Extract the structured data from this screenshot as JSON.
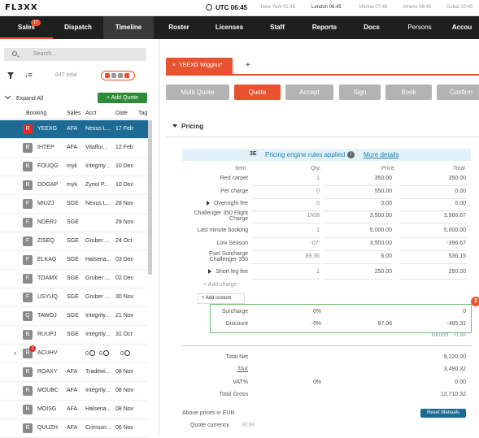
{
  "app": {
    "logo": "FL3XX"
  },
  "clocks": [
    {
      "id": "utc",
      "text": "UTC 06:45"
    },
    {
      "id": "ny",
      "text": "New York 01:45"
    },
    {
      "id": "london",
      "text": "London 06:45"
    },
    {
      "id": "vienna",
      "text": "Vienna 07:45"
    },
    {
      "id": "athens",
      "text": "Athens 08:45"
    },
    {
      "id": "dubai",
      "text": "Dubai 10:45"
    }
  ],
  "nav": {
    "items": [
      {
        "label": "Sales",
        "badge": "17"
      },
      {
        "label": "Dispatch"
      },
      {
        "label": "Timeline"
      },
      {
        "label": "Roster"
      },
      {
        "label": "Licenses"
      },
      {
        "label": "Staff"
      },
      {
        "label": "Reports"
      },
      {
        "label": "Docs"
      },
      {
        "label": "Persons"
      },
      {
        "label": "Accou"
      }
    ]
  },
  "sidebar": {
    "search_placeholder": "Search...",
    "total": "647 total",
    "add_quote": "+ Add Quote",
    "expand_all": "Expand All",
    "columns": [
      "Booking",
      "Sales",
      "Acct",
      "Date",
      "Tag"
    ],
    "rows": [
      {
        "s": "R",
        "booking": "YEEXG",
        "sales": "AFA",
        "acct": "Nexus L...",
        "date": "17 Feb"
      },
      {
        "s": "B",
        "booking": "IHTEP",
        "sales": "AFA",
        "acct": "Vitaflor...",
        "date": "12 Feb"
      },
      {
        "s": "B",
        "booking": "FOUQG",
        "sales": "myk",
        "acct": "Integrity...",
        "date": "10 Dec"
      },
      {
        "s": "B",
        "booking": "DOGAP",
        "sales": "myk",
        "acct": "Zynol P...",
        "date": "10 Dec"
      },
      {
        "s": "F",
        "booking": "MIUZJ",
        "sales": "SGE",
        "acct": "Nexus L...",
        "date": "28 Nov"
      },
      {
        "s": "F",
        "booking": "NOERJ",
        "sales": "SGE",
        "acct": "",
        "date": "29 Nov"
      },
      {
        "s": "F",
        "booking": "ZISEQ",
        "sales": "SGE",
        "acct": "Gruber ...",
        "date": "24 Oct"
      },
      {
        "s": "F",
        "booking": "ELKAQ",
        "sales": "SGE",
        "acct": "Halsena...",
        "date": "03 Dec"
      },
      {
        "s": "F",
        "booking": "TOAMX",
        "sales": "SGE",
        "acct": "Gruber ...",
        "date": "02 Dec"
      },
      {
        "s": "F",
        "booking": "USYUQ",
        "sales": "SGE",
        "acct": "Gruber ...",
        "date": "30 Nov"
      },
      {
        "s": "Q",
        "booking": "TAWOJ",
        "sales": "SGE",
        "acct": "Integrity...",
        "date": "21 Nov"
      },
      {
        "s": "B",
        "booking": "RUUPJ",
        "sales": "SGE",
        "acct": "Integrity...",
        "date": "31 Oct"
      },
      {
        "s": "R",
        "booking": "ACUHV",
        "sales": "",
        "acct": "0",
        "date": "0",
        "extra": "0",
        "badge": "1"
      },
      {
        "s": "R",
        "booking": "ROAXY",
        "sales": "AFA",
        "acct": "Tradewi...",
        "date": "08 Nov"
      },
      {
        "s": "R",
        "booking": "MOUBC",
        "sales": "AFA",
        "acct": "Integrity...",
        "date": "08 Nov"
      },
      {
        "s": "R",
        "booking": "MOISG",
        "sales": "AFA",
        "acct": "Halsena...",
        "date": "08 Nov"
      },
      {
        "s": "R",
        "booking": "QUUZH",
        "sales": "AFA",
        "acct": "Crimson...",
        "date": "06 Nov"
      }
    ]
  },
  "main": {
    "tab_label": "YEEXG Wiggins*",
    "tab_close": "×",
    "tab_add": "+",
    "buttons": [
      "Multi Quote",
      "Quote",
      "Accept",
      "Sign",
      "Book",
      "Confirm"
    ],
    "section": "Pricing",
    "engine_logo": "3E",
    "engine_text": "Pricing engine rules applied",
    "engine_info": "i",
    "engine_link": "More details",
    "headers": {
      "item": "Item",
      "qty": "Qty.",
      "price": "Price",
      "total": "Total"
    },
    "items": [
      {
        "label": "Red carpet",
        "qty": "1",
        "price": "350.00",
        "total": "350.00"
      },
      {
        "label": "Pet charge",
        "qty": "0",
        "price": "550.00",
        "total": "0.00"
      },
      {
        "label": "Overnight fee",
        "qty": "0",
        "price": "0.00",
        "total": "0.00",
        "tri": true
      },
      {
        "label": "Challenger 350 Flight Charge",
        "qty": "1h08",
        "price": "3,500.00",
        "total": "3,966.67",
        "two": true
      },
      {
        "label": "Last minute booking",
        "qty": "1",
        "price": "5,000.00",
        "total": "5,000.00"
      },
      {
        "label": "Low Season",
        "qty": "-07'",
        "price": "3,500.00",
        "total": "-396.67"
      },
      {
        "label": "Fuel Surcharge Challenger 350",
        "qty": "89.36",
        "price": "6.00",
        "total": "536.15",
        "two": true
      },
      {
        "label": "Short leg fee",
        "qty": "1",
        "price": "250.00",
        "total": "250.00",
        "tri": true
      }
    ],
    "add_charge": "+ Add charge",
    "add_custom": "+   Add custom",
    "surcharge": {
      "label": "Surcharge",
      "pct": "0",
      "unit": "%",
      "total": "0"
    },
    "discount": {
      "label": "Discount",
      "pct": "-5",
      "unit": "%",
      "price": "97.06",
      "total": "-485.31"
    },
    "badge": "2",
    "round": {
      "label": "Round",
      "value": "-0.84"
    },
    "totals": {
      "net": {
        "label": "Total Net",
        "value": "9,220.00"
      },
      "tax": {
        "label": "TAX",
        "value": "3,490.32"
      },
      "vat": {
        "label": "VAT%",
        "pct": "0",
        "unit": "%",
        "value": "0.00"
      },
      "gross": {
        "label": "Total Gross",
        "value": "12,710.32"
      }
    },
    "above": "Above prices in EUR",
    "reset": "Reset Manuals",
    "quote_currency": {
      "label": "Quote currency",
      "value": "EUR"
    }
  },
  "colors": {
    "accent": "#e8522e",
    "nav": "#1f1f1f",
    "selected_row": "#1d6b95",
    "green": "#2e8b3a"
  }
}
